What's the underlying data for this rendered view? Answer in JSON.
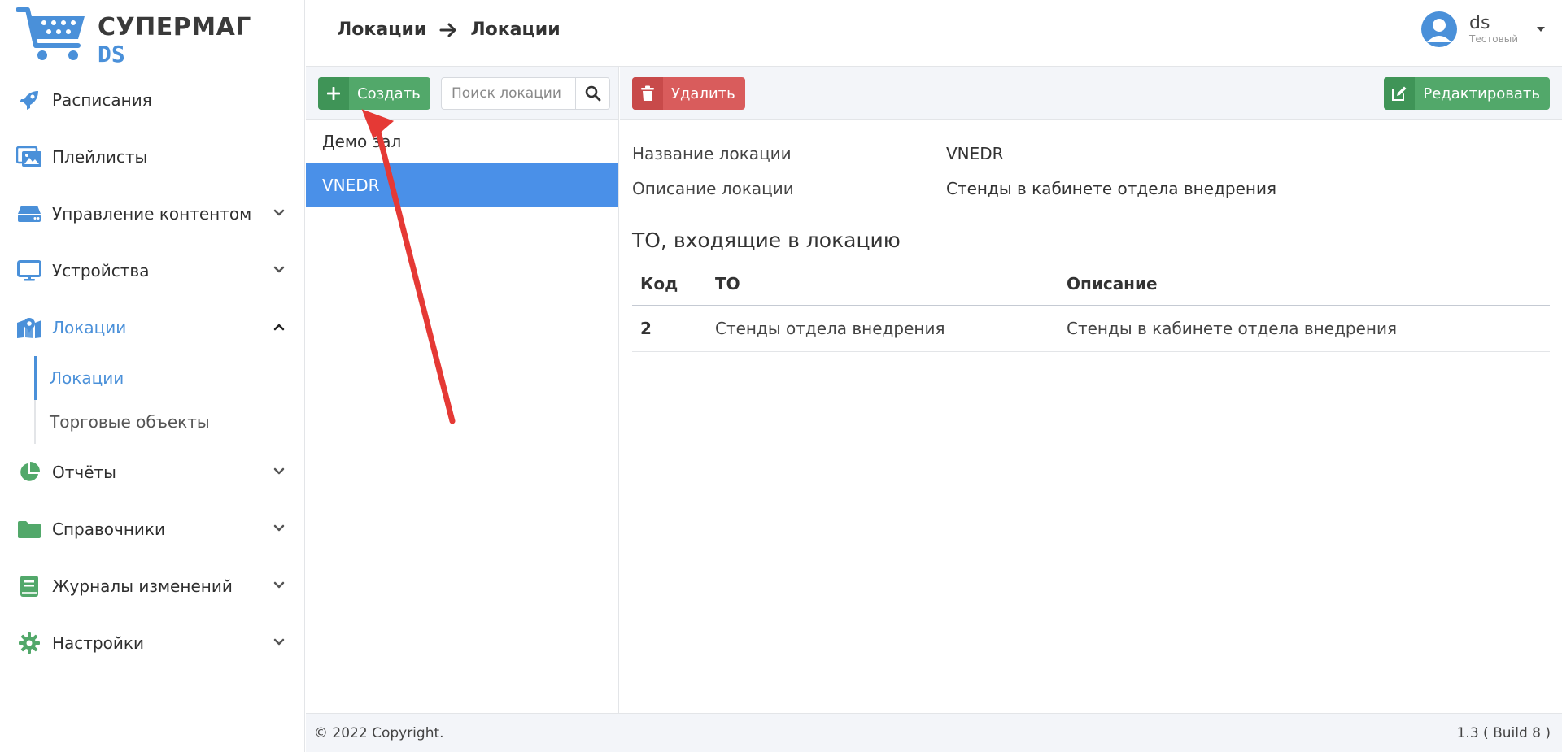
{
  "logo": {
    "brand": "СУПЕРМАГ",
    "sub": "DS"
  },
  "sidebar": {
    "items": [
      {
        "label": "Расписания",
        "icon": "rocket-icon"
      },
      {
        "label": "Плейлисты",
        "icon": "images-icon"
      },
      {
        "label": "Управление контентом",
        "icon": "server-icon"
      },
      {
        "label": "Устройства",
        "icon": "monitor-icon"
      },
      {
        "label": "Локации",
        "icon": "map-icon"
      },
      {
        "label": "Отчёты",
        "icon": "pie-chart-icon"
      },
      {
        "label": "Справочники",
        "icon": "folder-icon"
      },
      {
        "label": "Журналы изменений",
        "icon": "book-icon"
      },
      {
        "label": "Настройки",
        "icon": "gear-icon"
      }
    ],
    "sub_items": [
      {
        "label": "Локации"
      },
      {
        "label": "Торговые объекты"
      }
    ]
  },
  "header": {
    "crumb1": "Локации",
    "crumb2": "Локации",
    "user_name": "ds",
    "user_role": "Тестовый"
  },
  "left_panel": {
    "create_label": "Создать",
    "search_placeholder": "Поиск локации",
    "items": [
      {
        "label": "Демо зал"
      },
      {
        "label": "VNEDR"
      }
    ]
  },
  "right_panel": {
    "delete_label": "Удалить",
    "edit_label": "Редактировать",
    "name_key": "Название локации",
    "name_value": "VNEDR",
    "desc_key": "Описание локации",
    "desc_value": "Стенды в кабинете отдела внедрения",
    "subtitle": "ТО, входящие в локацию",
    "table": {
      "headers": [
        "Код",
        "ТО",
        "Описание"
      ],
      "rows": [
        [
          "2",
          "Стенды отдела внедрения",
          "Стенды в кабинете отдела внедрения"
        ]
      ]
    }
  },
  "footer": {
    "copyright": "© 2022 Copyright.",
    "version": "1.3 ( Build 8 )"
  },
  "colors": {
    "accent": "#4a90d9",
    "green": "#52a86a",
    "red": "#d95c5c",
    "arrow": "#e53935"
  }
}
